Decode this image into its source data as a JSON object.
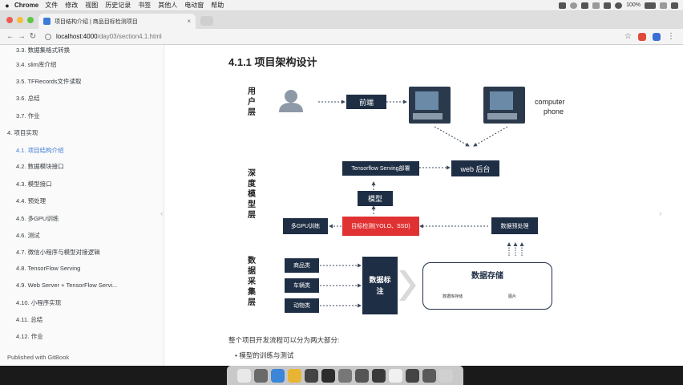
{
  "menubar": {
    "app": "Chrome",
    "items": [
      "文件",
      "修改",
      "视图",
      "历史记录",
      "书签",
      "其他人",
      "电动窗",
      "帮助"
    ],
    "battery": "100%"
  },
  "browser": {
    "tab_title": "项目结构介绍 | 商品目标检测项目",
    "url_host": "localhost:4000",
    "url_path": "/day03/section4.1.html"
  },
  "sidebar": {
    "items": [
      {
        "label": "3.3. 数据集格式转换",
        "level": 2
      },
      {
        "label": "3.4. slim库介绍",
        "level": 2
      },
      {
        "label": "3.5. TFRecords文件读取",
        "level": 2
      },
      {
        "label": "3.6. 总结",
        "level": 2
      },
      {
        "label": "3.7. 作业",
        "level": 2
      },
      {
        "label": "4. 项目实现",
        "level": 1
      },
      {
        "label": "4.1. 项目结构介绍",
        "level": 2,
        "active": true
      },
      {
        "label": "4.2. 数据模块接口",
        "level": 2
      },
      {
        "label": "4.3. 模型接口",
        "level": 2
      },
      {
        "label": "4.4. 预处理",
        "level": 2
      },
      {
        "label": "4.5. 多GPU训练",
        "level": 2
      },
      {
        "label": "4.6. 测试",
        "level": 2
      },
      {
        "label": "4.7. 微信小程序与模型对接逻辑",
        "level": 2
      },
      {
        "label": "4.8. TensorFlow Serving",
        "level": 2
      },
      {
        "label": "4.9. Web Server + TensorFlow Servi...",
        "level": 2
      },
      {
        "label": "4.10. 小程序实现",
        "level": 2
      },
      {
        "label": "4.11. 总结",
        "level": 2
      },
      {
        "label": "4.12. 作业",
        "level": 2
      }
    ],
    "footer": "Published with GitBook"
  },
  "content": {
    "heading": "4.1.1 项目架构设计",
    "paragraph": "整个项目开发流程可以分为两大部分:",
    "bullet": "模型的训练与测试"
  },
  "diagram": {
    "layers": {
      "user": "用户层",
      "model": "深度模型层",
      "data": "数据采集层"
    },
    "frontend": "前端",
    "devices": [
      "computer",
      "phone"
    ],
    "serving": "Tensorflow Serving部署",
    "web": "web 后台",
    "model": "模型",
    "multigpu": "多GPU训练",
    "detect": "目标检测(YOLO、SSD)",
    "preprocess": "数据预处理",
    "sources": [
      "商品类",
      "车辆类",
      "动物类"
    ],
    "label": "数据标注",
    "storage_title": "数据存储",
    "storage_subs": [
      "数据库存储",
      "图片"
    ]
  },
  "colors": {
    "navy": "#1e2e44",
    "red": "#e03232",
    "active_link": "#3d7bd8"
  }
}
